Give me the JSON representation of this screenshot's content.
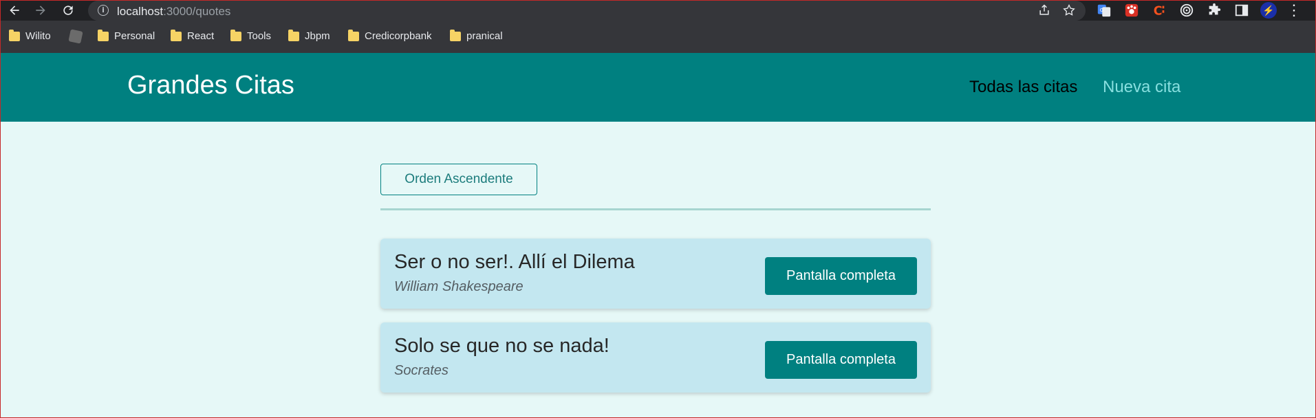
{
  "browser": {
    "url_host": "localhost",
    "url_rest": ":3000/quotes",
    "bookmarks": [
      {
        "label": "Wilito",
        "icon": "folder-icon"
      },
      {
        "label": "",
        "icon": "generic-bookmark-icon"
      },
      {
        "label": "Personal",
        "icon": "folder-icon"
      },
      {
        "label": "React",
        "icon": "folder-icon"
      },
      {
        "label": "Tools",
        "icon": "folder-icon"
      },
      {
        "label": "Jbpm",
        "icon": "folder-icon"
      },
      {
        "label": "Credicorpbank",
        "icon": "folder-icon"
      },
      {
        "label": "pranical",
        "icon": "folder-icon"
      }
    ]
  },
  "header": {
    "title": "Grandes Citas",
    "nav": [
      {
        "label": "Todas las citas",
        "active": true
      },
      {
        "label": "Nueva cita",
        "active": false
      }
    ]
  },
  "main": {
    "sort_label": "Orden Ascendente",
    "quotes": [
      {
        "text": "Ser o no ser!. Allí el Dilema",
        "author": "William Shakespeare",
        "button": "Pantalla completa"
      },
      {
        "text": "Solo se que no se nada!",
        "author": "Socrates",
        "button": "Pantalla completa"
      }
    ]
  },
  "colors": {
    "brand": "#008080",
    "page_bg": "#e6f8f7",
    "card_bg": "#c3e7f0",
    "nav_inactive": "#88dfdf"
  }
}
